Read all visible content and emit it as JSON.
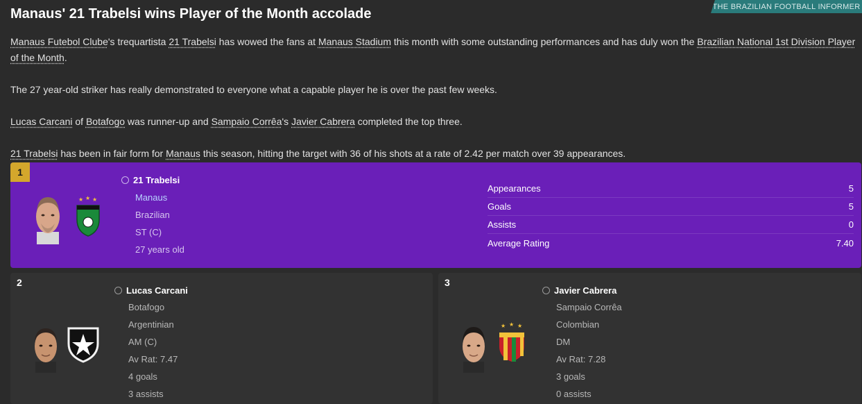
{
  "source": "THE BRAZILIAN FOOTBALL INFORMER",
  "headline": "Manaus' 21 Trabelsi wins Player of the Month accolade",
  "article": {
    "p1": {
      "club": "Manaus Futebol Clube",
      "t1": "'s trequartista ",
      "player": "21 Trabelsi",
      "t2": " has wowed the fans at ",
      "stadium": "Manaus Stadium",
      "t3": " this month with some outstanding performances and has duly won the ",
      "award": "Brazilian National 1st Division Player of the Month",
      "t4": "."
    },
    "p2": "The 27 year-old striker has really demonstrated to everyone what a capable player he is over the past few weeks.",
    "p3": {
      "runner": "Lucas Carcani",
      "t1": " of ",
      "runner_club": "Botafogo",
      "t2": " was runner-up and ",
      "third_club": "Sampaio Corrêa",
      "t3": "'s ",
      "third": "Javier Cabrera",
      "t4": " completed the top three."
    },
    "p4": {
      "player": "21 Trabelsi",
      "t1": " has been in fair form for ",
      "club": "Manaus",
      "t2": " this season, hitting the target with 36 of his shots at a rate of 2.42 per match over 39 appearances."
    }
  },
  "winner": {
    "rank": "1",
    "name": "21 Trabelsi",
    "club": "Manaus",
    "nationality": "Brazilian",
    "position": "ST (C)",
    "age": "27 years old",
    "stats": [
      {
        "label": "Appearances",
        "value": "5"
      },
      {
        "label": "Goals",
        "value": "5"
      },
      {
        "label": "Assists",
        "value": "0"
      },
      {
        "label": "Average Rating",
        "value": "7.40"
      }
    ]
  },
  "second": {
    "rank": "2",
    "name": "Lucas Carcani",
    "club": "Botafogo",
    "nationality": "Argentinian",
    "position": "AM (C)",
    "rating": "Av Rat: 7.47",
    "goals": "4 goals",
    "assists": "3 assists"
  },
  "third": {
    "rank": "3",
    "name": "Javier Cabrera",
    "club": "Sampaio Corrêa",
    "nationality": "Colombian",
    "position": "DM",
    "rating": "Av Rat: 7.28",
    "goals": "3 goals",
    "assists": "0 assists"
  },
  "colors": {
    "winner_bg": "#6a1fb8",
    "rank_badge": "#d4a72c",
    "source_tag": "#2a7b7b"
  }
}
